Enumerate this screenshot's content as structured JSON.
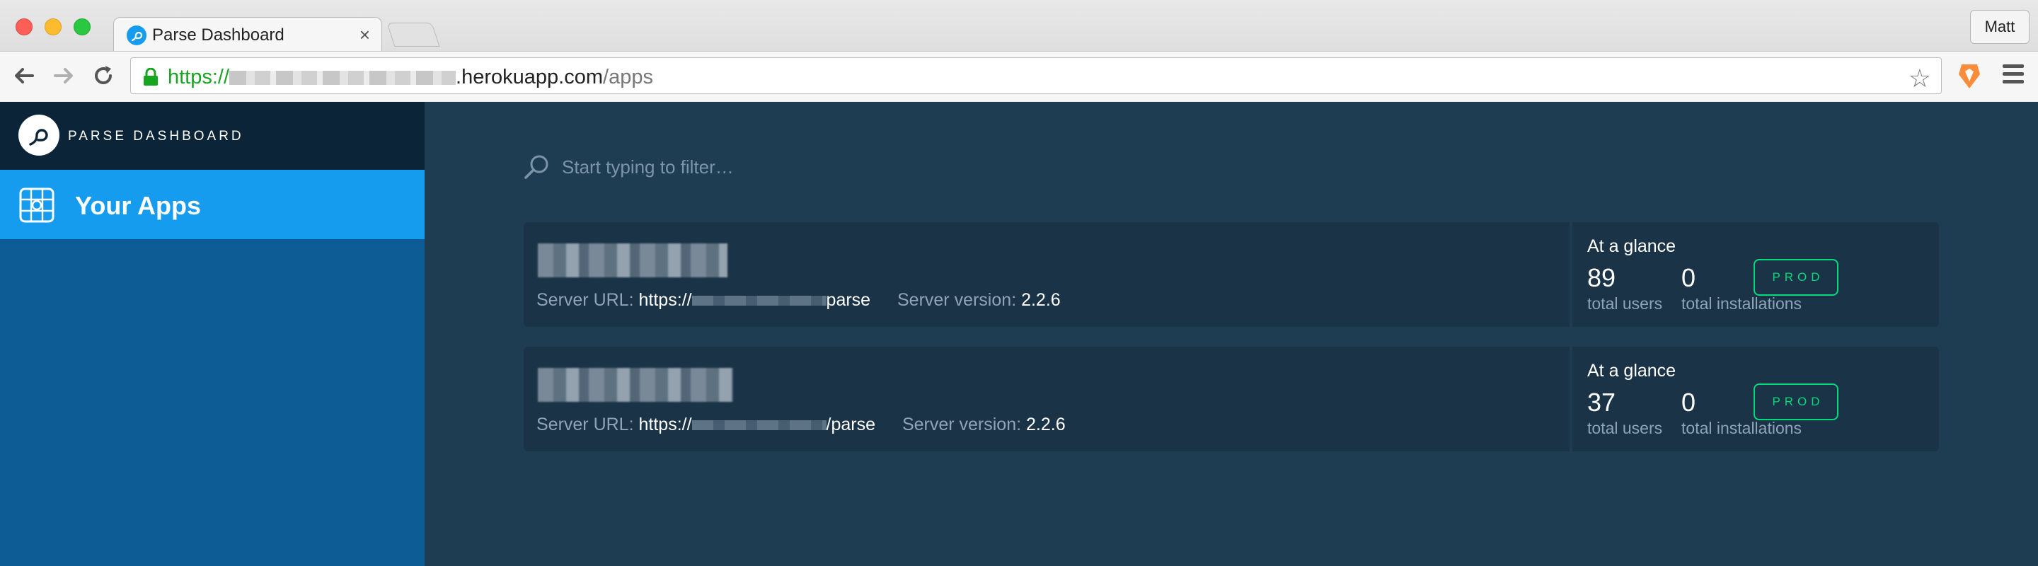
{
  "browser": {
    "tab_title": "Parse Dashboard",
    "tab_close": "×",
    "profile_name": "Matt",
    "url_scheme": "https://",
    "url_host": ".herokuapp.com",
    "url_path": "/apps"
  },
  "sidebar": {
    "brand": "PARSE DASHBOARD",
    "nav_item": "Your Apps"
  },
  "search": {
    "placeholder": "Start typing to filter…"
  },
  "apps": [
    {
      "server_url_label": "Server URL:",
      "server_url_prefix": "https://",
      "server_url_suffix": "parse",
      "server_version_label": "Server version:",
      "server_version": "2.2.6",
      "glance_label": "At a glance",
      "users_count": "89",
      "users_label": "total users",
      "installations_count": "0",
      "installations_label": "total installations",
      "badge": "PROD"
    },
    {
      "server_url_label": "Server URL:",
      "server_url_prefix": "https://",
      "server_url_suffix": "/parse",
      "server_version_label": "Server version:",
      "server_version": "2.2.6",
      "glance_label": "At a glance",
      "users_count": "37",
      "users_label": "total users",
      "installations_count": "0",
      "installations_label": "total installations",
      "badge": "PROD"
    }
  ],
  "colors": {
    "sidebar": "#0e5c95",
    "nav_active": "#169cee",
    "content_bg": "#1e3d53",
    "card_bg": "#1a3347",
    "prod_badge": "#00db7c",
    "url_scheme": "#17a51f"
  }
}
